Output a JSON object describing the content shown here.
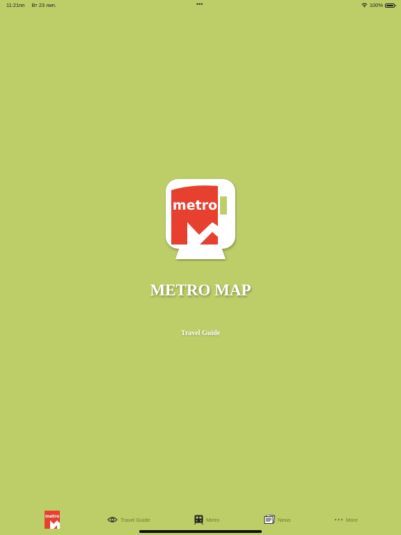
{
  "status_bar": {
    "time": "11:21пп",
    "date": "Вт 23 лип.",
    "dots": "•••",
    "battery": "100%"
  },
  "splash": {
    "logo_text": "metro",
    "title": "METRO MAP",
    "subtitle": "Travel Guide"
  },
  "tab_bar": {
    "home_logo_text": "metro",
    "items": [
      {
        "label": "Travel Guide",
        "icon": "eye-icon"
      },
      {
        "label": "Metro",
        "icon": "train-icon"
      },
      {
        "label": "News",
        "icon": "newspaper-icon"
      },
      {
        "label": "More",
        "icon": "more-dots-icon"
      }
    ]
  },
  "colors": {
    "background": "#bdce69",
    "logo_red": "#e8402f",
    "tab_text": "#6e7d2a"
  }
}
